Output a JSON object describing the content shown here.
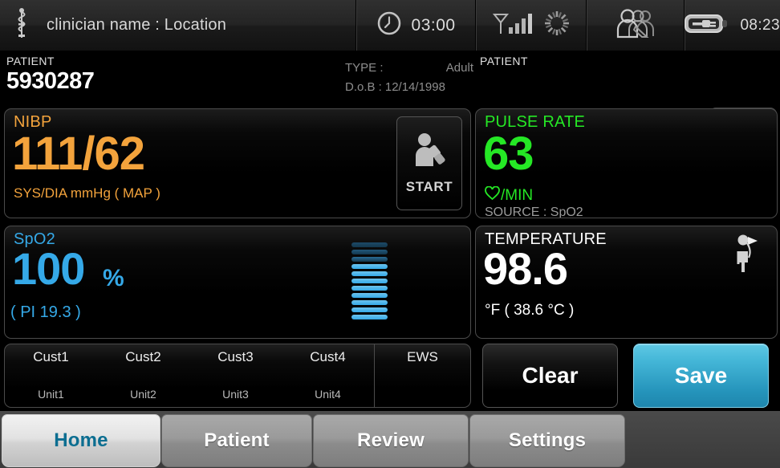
{
  "header": {
    "clinician": "clinician name : Location",
    "caduceus_icon": "caduceus-icon",
    "timer_icon": "clock-icon",
    "timer": "03:00",
    "signal_icon": "antenna-signal-icon",
    "spinner_icon": "busy-spinner-icon",
    "users_icon": "patients-group-icon",
    "battery_icon": "battery-plugged-icon",
    "battery_time": "08:23"
  },
  "patient_bar": {
    "left_label": "PATIENT",
    "patient_id": "5930287",
    "type_label": "TYPE :",
    "type_value": "Adult",
    "dob_label": "D.o.B :",
    "dob_value": "12/14/1998",
    "right_label": "PATIENT",
    "play_icon": "play-triangle-icon"
  },
  "nibp": {
    "title": "NIBP",
    "value": "111/62",
    "units": "SYS/DIA mmHg ( MAP )",
    "start_label": "START",
    "start_icon": "bp-cuff-person-icon",
    "color": "#F3A33C"
  },
  "pulse": {
    "title": "PULSE RATE",
    "value": "63",
    "units": "/MIN",
    "heart_icon": "heart-outline-icon",
    "source": "SOURCE : SpO2",
    "color": "#25E825"
  },
  "spo2": {
    "title": "SpO2",
    "value": "100",
    "percent": "%",
    "pi": "( PI 19.3 )",
    "pleth_icon": "pleth-bar-graph",
    "pleth_total": 11,
    "pleth_lit": 8,
    "color": "#35A9E8"
  },
  "temperature": {
    "title": "TEMPERATURE",
    "value": "98.6",
    "units": "°F  ( 38.6 °C )",
    "site_icon": "oral-thermometer-person-icon",
    "color": "#FFFFFF"
  },
  "custom_row": {
    "cells": [
      {
        "top": "Cust1",
        "bottom": "Unit1"
      },
      {
        "top": "Cust2",
        "bottom": "Unit2"
      },
      {
        "top": "Cust3",
        "bottom": "Unit3"
      },
      {
        "top": "Cust4",
        "bottom": "Unit4"
      }
    ],
    "ews_label": "EWS"
  },
  "actions": {
    "clear_label": "Clear",
    "save_label": "Save",
    "save_color": "#2fa3ca"
  },
  "tabs": {
    "items": [
      {
        "label": "Home",
        "active": true
      },
      {
        "label": "Patient",
        "active": false
      },
      {
        "label": "Review",
        "active": false
      },
      {
        "label": "Settings",
        "active": false
      }
    ],
    "active_color": "#0c6e91"
  }
}
